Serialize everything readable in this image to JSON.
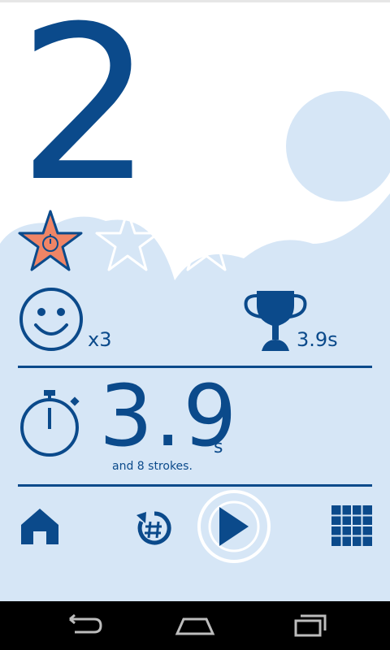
{
  "level": {
    "number": "2",
    "stars_earned": 1,
    "stars_total": 3
  },
  "stats": {
    "smiley_count": "x3",
    "best_time": "3.9s"
  },
  "result": {
    "time": "3.9",
    "unit": "s",
    "strokes_text": "and 8 strokes."
  },
  "icons": {
    "star_earned": "star-timer-icon",
    "star_empty": "star-outline-icon",
    "smiley": "smiley-icon",
    "trophy": "trophy-icon",
    "stopwatch": "stopwatch-icon",
    "home": "home-icon",
    "retry": "retry-icon",
    "play": "play-icon",
    "level_grid": "grid-icon"
  },
  "colors": {
    "primary": "#0b4a8b",
    "sky": "#d6e6f6",
    "star_fill": "#f08566",
    "white": "#ffffff"
  }
}
